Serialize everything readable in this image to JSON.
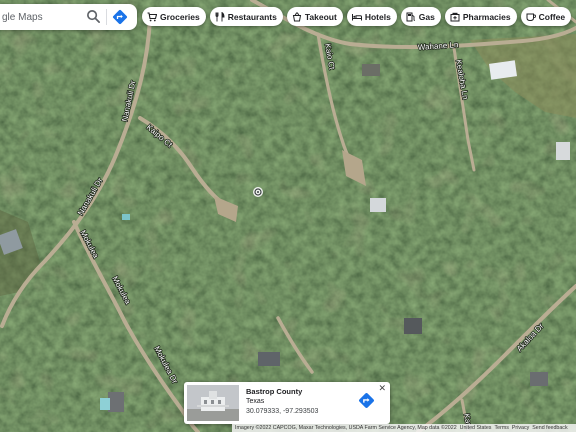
{
  "search": {
    "placeholder": "gle Maps"
  },
  "chips": [
    {
      "label": "Groceries",
      "icon": "cart-icon"
    },
    {
      "label": "Restaurants",
      "icon": "fork-knife-icon"
    },
    {
      "label": "Takeout",
      "icon": "takeout-icon"
    },
    {
      "label": "Hotels",
      "icon": "bed-icon"
    },
    {
      "label": "Gas",
      "icon": "gas-pump-icon"
    },
    {
      "label": "Pharmacies",
      "icon": "pharmacy-icon"
    },
    {
      "label": "Coffee",
      "icon": "coffee-cup-icon"
    }
  ],
  "map": {
    "road_labels": {
      "wahane": "Wahane Ln",
      "kealoha": "Kealoha Ln",
      "kaio": "Kaio Ct",
      "kaipo": "Kaipo Ct",
      "nanakuli_upper": "Nanakuli Dr",
      "nanakuli_lower": "Nanakuli Dr",
      "mokulea_upper": "Mokulea",
      "mokulea_mid": "Mokulea",
      "mokulea_lower": "Mokulea Dr",
      "akaloa": "Akaloa Dr",
      "kama": "Kam"
    },
    "colors": {
      "canopy": "#2b3a25",
      "road": "#b9ad93"
    }
  },
  "info_card": {
    "title": "Bastrop County",
    "subtitle": "Texas",
    "coordinates": "30.079333, -97.293503",
    "close_glyph": "✕"
  },
  "attribution": {
    "imagery": "Imagery ©2022 CAPCOG, Maxar Technologies, USDA Farm Service Agency, Map data ©2022",
    "region": "United States",
    "terms": "Terms",
    "privacy": "Privacy",
    "feedback": "Send feedback"
  }
}
